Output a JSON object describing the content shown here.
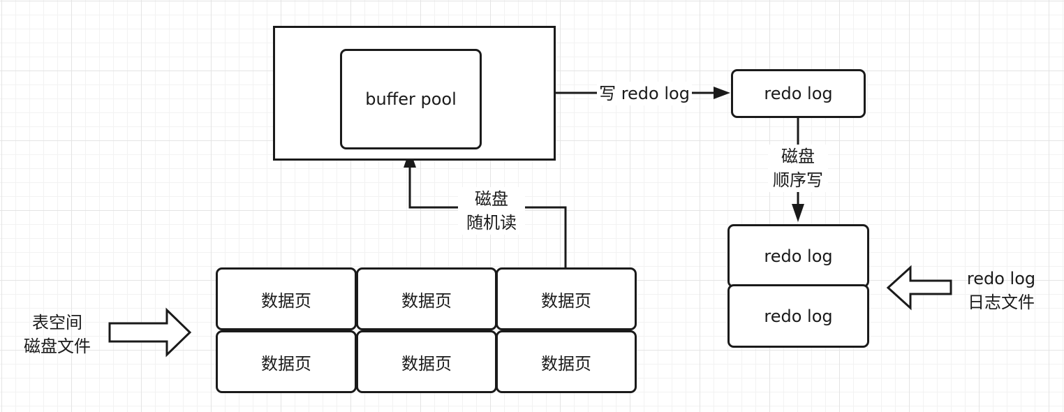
{
  "memory": {
    "buffer_pool": "buffer pool"
  },
  "edges": {
    "write_redo_log": "写 redo log",
    "random_read": {
      "line1": "磁盘",
      "line2": "随机读"
    },
    "sequential_write": {
      "line1": "磁盘",
      "line2": "顺序写"
    }
  },
  "redo_buffer": "redo log",
  "redo_files": [
    "redo log",
    "redo log"
  ],
  "redo_file_label": {
    "line1": "redo log",
    "line2": "日志文件"
  },
  "tablespace_label": {
    "line1": "表空间",
    "line2": "磁盘文件"
  },
  "data_pages": [
    [
      "数据页",
      "数据页",
      "数据页"
    ],
    [
      "数据页",
      "数据页",
      "数据页"
    ]
  ]
}
